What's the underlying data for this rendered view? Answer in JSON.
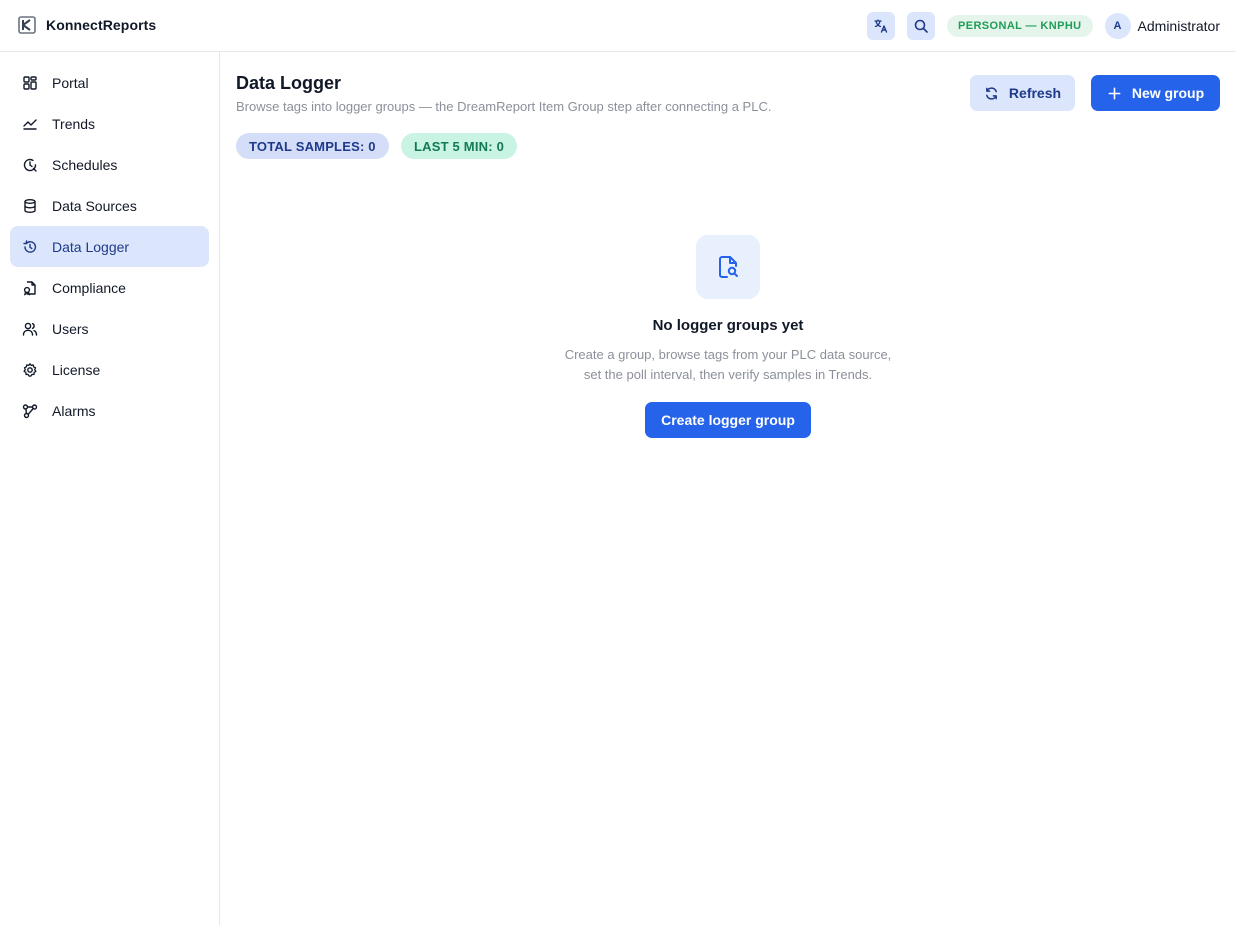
{
  "app": {
    "name": "KonnectReports",
    "logo_icon": "k-logo-icon"
  },
  "topbar": {
    "translate_icon": "translate-icon",
    "search_icon": "search-icon",
    "plan_badge": "PERSONAL — KNPHU",
    "user": {
      "initial": "A",
      "name": "Administrator"
    }
  },
  "sidebar": {
    "items": [
      {
        "label": "Portal",
        "icon": "grid-icon",
        "active": false
      },
      {
        "label": "Trends",
        "icon": "trend-line-icon",
        "active": false
      },
      {
        "label": "Schedules",
        "icon": "clock-refresh-icon",
        "active": false
      },
      {
        "label": "Data Sources",
        "icon": "database-icon",
        "active": false
      },
      {
        "label": "Data Logger",
        "icon": "history-icon",
        "active": true
      },
      {
        "label": "Compliance",
        "icon": "file-check-icon",
        "active": false
      },
      {
        "label": "Users",
        "icon": "users-icon",
        "active": false
      },
      {
        "label": "License",
        "icon": "gear-icon",
        "active": false
      },
      {
        "label": "Alarms",
        "icon": "share-nodes-icon",
        "active": false
      }
    ]
  },
  "page": {
    "title": "Data Logger",
    "subtitle": "Browse tags into logger groups — the DreamReport Item Group step after connecting a PLC.",
    "refresh_label": "Refresh",
    "new_group_label": "New group",
    "stats": {
      "total_samples": "TOTAL SAMPLES: 0",
      "last_5_min": "LAST 5 MIN: 0"
    },
    "empty": {
      "icon": "file-search-icon",
      "title": "No logger groups yet",
      "line1": "Create a group, browse tags from your PLC data source,",
      "line2": "set the poll interval, then verify samples in Trends.",
      "create_label": "Create logger group"
    }
  },
  "colors": {
    "accent": "#2563eb",
    "accent_soft": "#dbe5fb",
    "success": "#1f9d57",
    "border": "#e5e7eb"
  }
}
